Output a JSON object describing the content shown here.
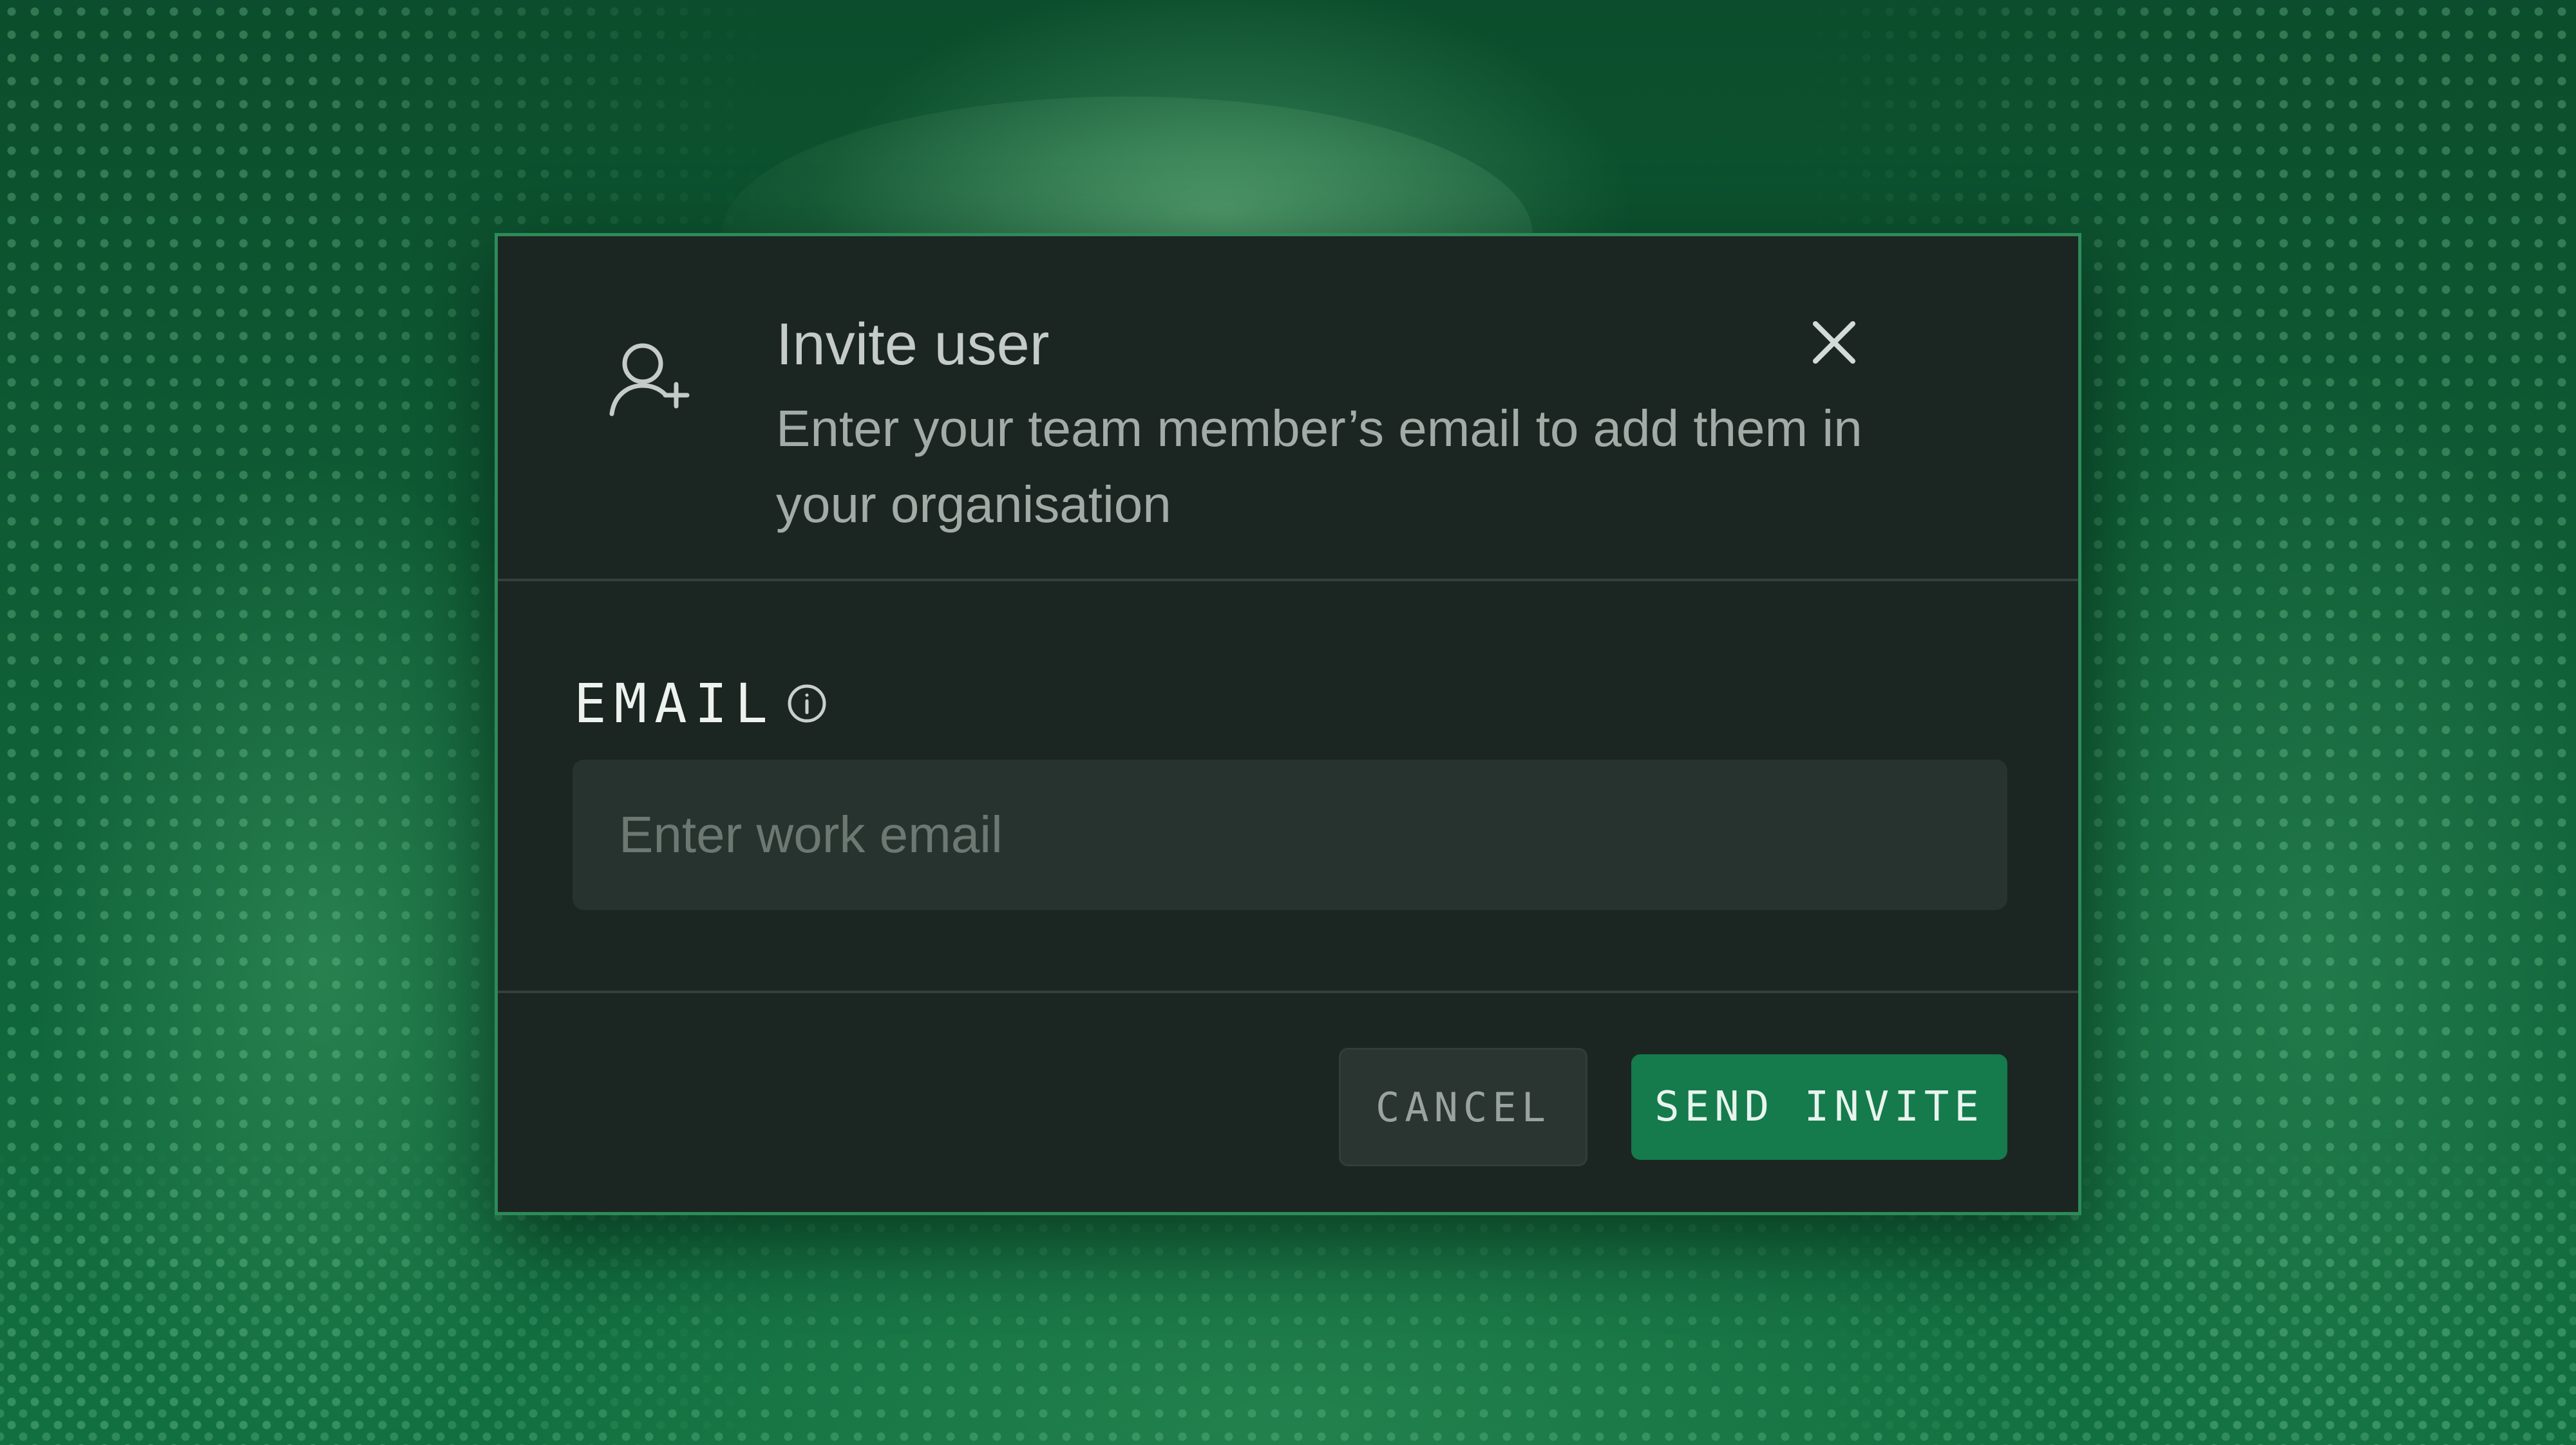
{
  "dialog": {
    "title": "Invite user",
    "subtitle": "Enter your team member’s email to add them in your organisation",
    "icon": "user-plus-icon",
    "close_icon": "close-icon"
  },
  "form": {
    "email_label": "EMAIL",
    "info_icon": "info-icon",
    "email_placeholder": "Enter work email",
    "email_value": ""
  },
  "actions": {
    "cancel_label": "CANCEL",
    "send_label": "SEND INVITE"
  },
  "colors": {
    "background": "#0f5e35",
    "modal": "#1b2622",
    "modal_border": "#2e8a5a",
    "primary_button": "#157a4c",
    "secondary_button": "#2a3531"
  }
}
